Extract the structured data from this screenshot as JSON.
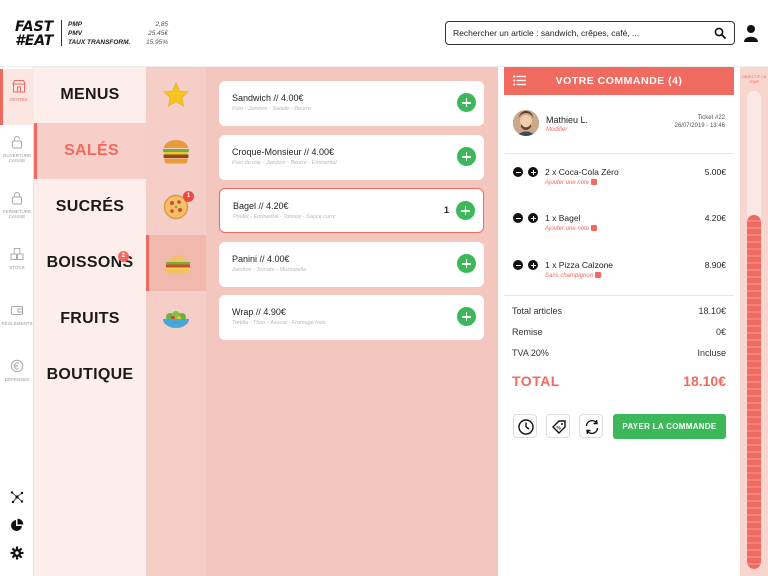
{
  "brand": {
    "logo_line1": "FAST",
    "logo_line2": "#EAT"
  },
  "kpis": [
    {
      "label": "PMP",
      "value": "2,85"
    },
    {
      "label": "PMV",
      "value": "25.45€"
    },
    {
      "label": "TAUX TRANSFORM.",
      "value": "15.95%"
    }
  ],
  "search": {
    "value": "Rechercher un article : sandwich, crêpes, café, ..."
  },
  "icons": {
    "search": "search-icon",
    "user": "user-icon"
  },
  "sidebar": {
    "items": [
      {
        "label": "VENTES",
        "icon": "shop-icon",
        "active": true
      },
      {
        "label": "OUVERTURE CAISSE",
        "icon": "lock-open-icon",
        "active": false
      },
      {
        "label": "FERMETURE CAISSE",
        "icon": "lock-closed-icon",
        "active": false
      },
      {
        "label": "STOCK",
        "icon": "boxes-icon",
        "active": false
      },
      {
        "label": "RÈGLEMENTS",
        "icon": "wallet-icon",
        "active": false
      },
      {
        "label": "DÉPENSES",
        "icon": "euro-icon",
        "active": false
      }
    ],
    "bottom": [
      "network-icon",
      "pie-chart-icon",
      "gear-icon"
    ]
  },
  "categories": [
    {
      "label": "MENUS",
      "active": false,
      "badge": ""
    },
    {
      "label": "SALÉS",
      "active": true,
      "badge": ""
    },
    {
      "label": "SUCRÉS",
      "active": false,
      "badge": ""
    },
    {
      "label": "BOISSONS",
      "active": false,
      "badge": "2"
    },
    {
      "label": "FRUITS",
      "active": false,
      "badge": ""
    },
    {
      "label": "BOUTIQUE",
      "active": false,
      "badge": ""
    }
  ],
  "subcategories": [
    {
      "icon": "star-icon",
      "active": false,
      "badge": ""
    },
    {
      "icon": "burger-icon",
      "active": false,
      "badge": ""
    },
    {
      "icon": "pizza-icon",
      "active": false,
      "badge": "1"
    },
    {
      "icon": "sandwich-icon",
      "active": true,
      "badge": ""
    },
    {
      "icon": "salad-icon",
      "active": false,
      "badge": ""
    }
  ],
  "products": [
    {
      "name": "Sandwich // 4.00€",
      "desc": "Pain - Jambon - Salade - Beurre",
      "qty": "",
      "selected": false
    },
    {
      "name": "Croque-Monsieur // 4.00€",
      "desc": "Pain de mie - Jambon - Beurre - Emmental",
      "qty": "",
      "selected": false
    },
    {
      "name": "Bagel // 4.20€",
      "desc": "Poulet - Emmental - Tomate - Sauce curry",
      "qty": "1",
      "selected": true
    },
    {
      "name": "Panini // 4.00€",
      "desc": "Jambon - Tomate - Mozzarella",
      "qty": "",
      "selected": false
    },
    {
      "name": "Wrap // 4.90€",
      "desc": "Tortilla - Thon - Avocat - Fromage frais",
      "qty": "",
      "selected": false
    }
  ],
  "order": {
    "title": "VOTRE COMMANDE (4)",
    "customer": {
      "name": "Mathieu L.",
      "edit": "Modifier"
    },
    "ticket": {
      "number": "Ticket #22",
      "date": "26/07/2019 - 13:46"
    },
    "lines": [
      {
        "label": "2 x Coca-Cola Zéro",
        "note": "Ajouter une note",
        "price": "5.00€"
      },
      {
        "label": "1 x Bagel",
        "note": "Ajouter une note",
        "price": "4.20€"
      },
      {
        "label": "1 x Pizza Calzone",
        "note": "Sans champignon",
        "price": "8.90€"
      }
    ],
    "summary": [
      {
        "label": "Total articles",
        "value": "18.10€"
      },
      {
        "label": "Remise",
        "value": "0€"
      },
      {
        "label": "TVA 20%",
        "value": "Incluse"
      }
    ],
    "total_label": "TOTAL",
    "total_value": "18.10€",
    "actions": [
      "clock-icon",
      "discount-tag-icon",
      "refresh-icon"
    ],
    "pay_label": "PAYER LA COMMANDE"
  },
  "rail": {
    "label": "OBJECTIF CA JOUR",
    "progress": 0.74
  },
  "colors": {
    "accent": "#f06a60",
    "success": "#3cb85a",
    "panel_light": "#fdeeeb",
    "panel_mid": "#f3c7be"
  }
}
